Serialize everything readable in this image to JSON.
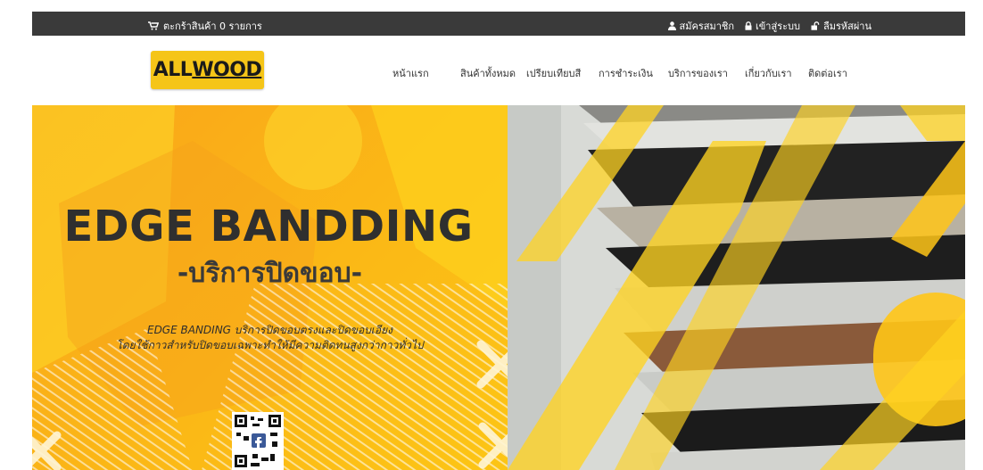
{
  "topbar": {
    "cart_label": "ตะกร้าสินค้า 0 รายการ",
    "register_label": "สมัครสมาชิก",
    "login_label": "เข้าสู่ระบบ",
    "forgot_label": "ลืมรหัสผ่าน"
  },
  "header": {
    "logo_prefix": "ALL",
    "logo_suffix": "WOOD"
  },
  "nav": {
    "items": [
      "หน้าแรก",
      "สินค้าทั้งหมด",
      "เปรียบเทียบสี",
      "การชำระเงิน",
      "บริการของเรา",
      "เกี่ยวกับเรา",
      "ติดต่อเรา"
    ]
  },
  "hero": {
    "headline": "EDGE BANDDING",
    "subheadline": "-บริการปิดขอบ-",
    "desc_line1": "EDGE BANDING บริการปิดขอบตรงและปิดขอบเอียง",
    "desc_line2": "โดยใช้กาวสำหรับปิดขอบเฉพาะทำให้มีความติดทนสูงกว่ากาวทั่วไป"
  },
  "colors": {
    "topbar_bg": "#3a3a3a",
    "accent_yellow": "#f5c518",
    "hero_orange": "#fbb515"
  },
  "icons": {
    "cart": "shopping-cart-icon",
    "register": "user-icon",
    "login": "lock-icon",
    "forgot": "unlock-icon"
  }
}
